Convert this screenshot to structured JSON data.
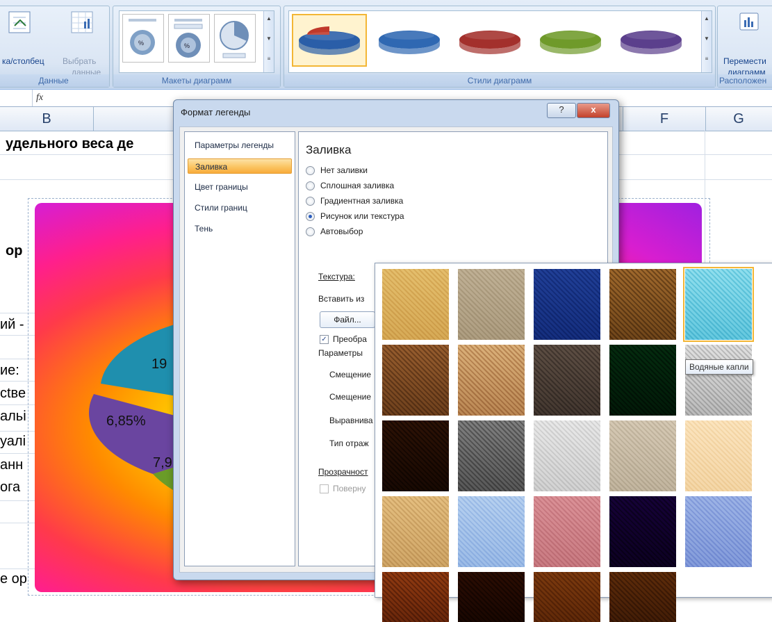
{
  "ribbon": {
    "data_group": {
      "label": "Данные",
      "switch_button_label": "ка/столбец",
      "select_button_label_1": "Выбрать",
      "select_button_label_2": "данные"
    },
    "layouts_group": {
      "label": "Макеты диаграмм"
    },
    "styles_group": {
      "label": "Стили диаграмм",
      "styles": [
        {
          "color": "#2a5ea8",
          "accent": "#c0392b"
        },
        {
          "color": "#2f68b2"
        },
        {
          "color": "#a3302c"
        },
        {
          "color": "#6f9a2a"
        },
        {
          "color": "#5b3f8c"
        }
      ]
    },
    "location_group": {
      "label": "Расположен",
      "button_label_1": "Перемести",
      "button_label_2": "диаграмм"
    }
  },
  "formula_bar": {
    "fx": "fx"
  },
  "columns": [
    "B",
    "F",
    "G"
  ],
  "sheet": {
    "title_text": "удельного веса де",
    "cell_or_1": "ор",
    "cell_iy": "ий -",
    "cell_ie": "ие:",
    "cell_stve": "ctве",
    "cell_aly": "альі",
    "cell_yal": "уалі",
    "cell_ann": "анн",
    "cell_org": "ога",
    "cell_or_2": "е ор"
  },
  "chart": {
    "labels": [
      "19",
      "6,85%",
      "7,9"
    ],
    "slice_colors": {
      "teal": "#2aa0c0",
      "purple": "#7a4fb0",
      "green": "#7aae2e"
    }
  },
  "dialog": {
    "title": "Формат легенды",
    "help_button": "?",
    "close_button": "x",
    "nav": [
      "Параметры легенды",
      "Заливка",
      "Цвет границы",
      "Стили границ",
      "Тень"
    ],
    "selected_nav": 1,
    "section_title": "Заливка",
    "fill_options": [
      {
        "label": "Нет заливки",
        "checked": false
      },
      {
        "label": "Сплошная заливка",
        "checked": false
      },
      {
        "label": "Градиентная заливка",
        "checked": false
      },
      {
        "label": "Рисунок или текстура",
        "checked": true
      },
      {
        "label": "Автовыбор",
        "checked": false
      }
    ],
    "texture_label": "Текстура:",
    "insert_from_label": "Вставить из",
    "file_button": "Файл...",
    "tile_checkbox_label": "Преобра",
    "params_label": "Параметры",
    "offset1_label": "Смещение",
    "offset2_label": "Смещение",
    "align_label": "Выравнива",
    "mirror_label": "Тип отраж",
    "transparency_label": "Прозрачност",
    "rotate_label": "Поверну"
  },
  "texture_gallery": {
    "tooltip": "Водяные капли",
    "selected_index": 4,
    "textures": [
      {
        "name": "papyrus",
        "c1": "#f1dca6",
        "c2": "#e3c585"
      },
      {
        "name": "canvas",
        "c1": "#ddd4c3",
        "c2": "#c8bda8"
      },
      {
        "name": "denim",
        "c1": "#5b7fc4",
        "c2": "#3b5ea4"
      },
      {
        "name": "woven-mat",
        "c1": "#c9a36a",
        "c2": "#8e6d3e"
      },
      {
        "name": "water-droplets",
        "c1": "#bfeef6",
        "c2": "#86d6e6"
      },
      {
        "name": "paper-bag",
        "c1": "#c49a6c",
        "c2": "#8f6a44"
      },
      {
        "name": "fish-fossil",
        "c1": "#ecd4b0",
        "c2": "#c9a37a"
      },
      {
        "name": "sand",
        "c1": "#9a8d83",
        "c2": "#6e635c"
      },
      {
        "name": "green-marble",
        "c1": "#1f6a3e",
        "c2": "#0b3e22"
      },
      {
        "name": "white-marble",
        "c1": "#efefef",
        "c2": "#c7c7c7"
      },
      {
        "name": "brown-marble",
        "c1": "#6b4424",
        "c2": "#3b2210"
      },
      {
        "name": "granite",
        "c1": "#b4b4b4",
        "c2": "#7c7c7c"
      },
      {
        "name": "newsprint",
        "c1": "#f3f3f3",
        "c2": "#dcdcdc"
      },
      {
        "name": "recycled-paper",
        "c1": "#e9e2d6",
        "c2": "#d4ccbd"
      },
      {
        "name": "parchment",
        "c1": "#fdf1dc",
        "c2": "#f6e3c2"
      },
      {
        "name": "stationery",
        "c1": "#f1dcb4",
        "c2": "#dcc193"
      },
      {
        "name": "blue-tissue",
        "c1": "#d7e6f7",
        "c2": "#b9d0ee"
      },
      {
        "name": "pink-tissue",
        "c1": "#ecc0c4",
        "c2": "#d9a3a9"
      },
      {
        "name": "purple-mesh",
        "c1": "#4b1478",
        "c2": "#2a0a48"
      },
      {
        "name": "bouquet",
        "c1": "#c8d6f2",
        "c2": "#a7b9e6"
      },
      {
        "name": "cork",
        "c1": "#c07a42",
        "c2": "#8c5128"
      },
      {
        "name": "walnut",
        "c1": "#6a3a1a",
        "c2": "#3e1e0a"
      },
      {
        "name": "oak",
        "c1": "#b27a3c",
        "c2": "#8a5624"
      },
      {
        "name": "medium-wood",
        "c1": "#9b6a32",
        "c2": "#6e4620"
      }
    ]
  }
}
